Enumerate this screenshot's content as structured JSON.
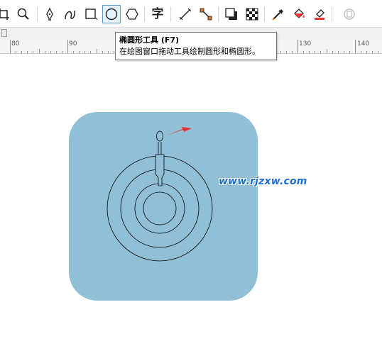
{
  "toolbar": {
    "tools": [
      {
        "name": "crop-tool",
        "icon": "crop-icon"
      },
      {
        "name": "zoom-tool",
        "icon": "zoom-icon"
      },
      {
        "name": "pen-tool",
        "icon": "pen-nib-icon"
      },
      {
        "name": "smart-draw-tool",
        "icon": "curve-icon"
      },
      {
        "name": "rectangle-tool",
        "icon": "rectangle-icon"
      },
      {
        "name": "ellipse-tool",
        "icon": "ellipse-icon",
        "active": true
      },
      {
        "name": "polygon-tool",
        "icon": "hexagon-icon"
      },
      {
        "name": "text-tool",
        "icon": "text-icon"
      },
      {
        "name": "parallel-dimension-tool",
        "icon": "dimension-icon"
      },
      {
        "name": "connector-tool",
        "icon": "connector-icon"
      },
      {
        "name": "drop-shadow-tool",
        "icon": "shadow-icon"
      },
      {
        "name": "transparency-tool",
        "icon": "checkerboard-icon"
      },
      {
        "name": "eyedropper-tool",
        "icon": "eyedropper-icon"
      },
      {
        "name": "interactive-fill-tool",
        "icon": "fill-bucket-icon"
      },
      {
        "name": "smart-fill-tool",
        "icon": "smart-fill-icon"
      },
      {
        "name": "disabled-tool",
        "icon": "disabled-icon"
      }
    ],
    "text_tool_glyph": "字"
  },
  "ruler": {
    "labels": [
      "80",
      "90",
      "130",
      "140"
    ]
  },
  "tooltip": {
    "title": "椭圆形工具 (F7)",
    "description": "在绘图窗口拖动工具绘制圆形和椭圆形。"
  },
  "canvas": {
    "background_color": "#91c0d6",
    "arrow_color": "#e53030",
    "stroke_color": "#000000"
  },
  "watermark": {
    "text": "www.rjzxw.com",
    "color": "#1f6fd0"
  }
}
